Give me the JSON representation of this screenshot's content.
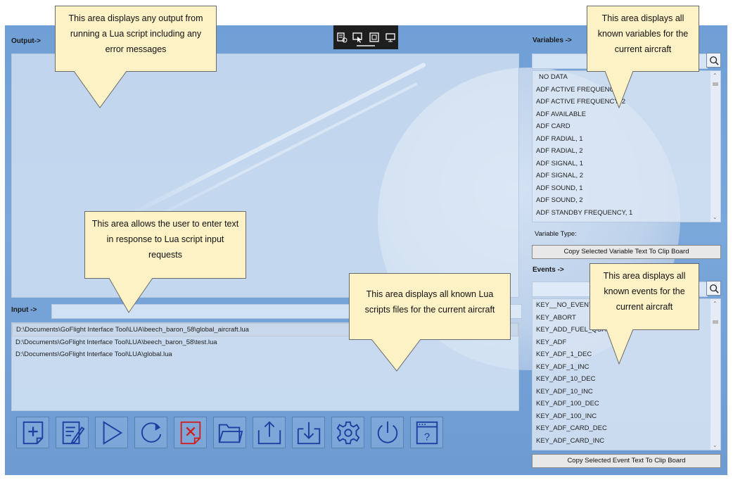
{
  "output": {
    "label": "Output->"
  },
  "input": {
    "label": "Input ->",
    "value": ""
  },
  "files": [
    "D:\\Documents\\GoFlight Interface Tool\\LUA\\beech_baron_58\\global_aircraft.lua",
    "D:\\Documents\\GoFlight Interface Tool\\LUA\\beech_baron_58\\test.lua",
    "D:\\Documents\\GoFlight Interface Tool\\LUA\\global.lua"
  ],
  "variables": {
    "label": "Variables ->",
    "search_value": "",
    "items": [
      "NO DATA",
      "ADF ACTIVE FREQUENCY, 1",
      "ADF ACTIVE FREQUENCY, 2",
      "ADF AVAILABLE",
      "ADF CARD",
      "ADF RADIAL, 1",
      "ADF RADIAL, 2",
      "ADF SIGNAL, 1",
      "ADF SIGNAL, 2",
      "ADF SOUND, 1",
      "ADF SOUND, 2",
      "ADF STANDBY FREQUENCY, 1"
    ],
    "type_label": "Variable Type:",
    "copy_label": "Copy Selected Variable Text To Clip Board"
  },
  "events": {
    "label": "Events ->",
    "search_value": "",
    "items": [
      "KEY__NO_EVENT",
      "KEY_ABORT",
      "KEY_ADD_FUEL_QUANTITY",
      "KEY_ADF",
      "KEY_ADF_1_DEC",
      "KEY_ADF_1_INC",
      "KEY_ADF_10_DEC",
      "KEY_ADF_10_INC",
      "KEY_ADF_100_DEC",
      "KEY_ADF_100_INC",
      "KEY_ADF_CARD_DEC",
      "KEY_ADF_CARD_INC"
    ],
    "copy_label": "Copy Selected Event Text To Clip Board"
  },
  "toolbar_icons": [
    "new-script-icon",
    "edit-script-icon",
    "run-icon",
    "reload-icon",
    "delete-script-icon",
    "open-folder-icon",
    "export-icon",
    "import-icon",
    "settings-icon",
    "power-icon",
    "help-window-icon"
  ],
  "callouts": {
    "output": "This area displays any output from running a Lua script including any error messages",
    "input": "This area allows the user to enter text in response to Lua script input requests",
    "files": "This area displays all known Lua scripts files for the current aircraft",
    "variables": "This area displays all known variables for the current aircraft",
    "events": "This area displays all known events for the current aircraft"
  },
  "colors": {
    "background": "#7aa7da",
    "callout": "#fdf1c6",
    "icon_blue": "#1c3fa0",
    "icon_red": "#d02020"
  }
}
